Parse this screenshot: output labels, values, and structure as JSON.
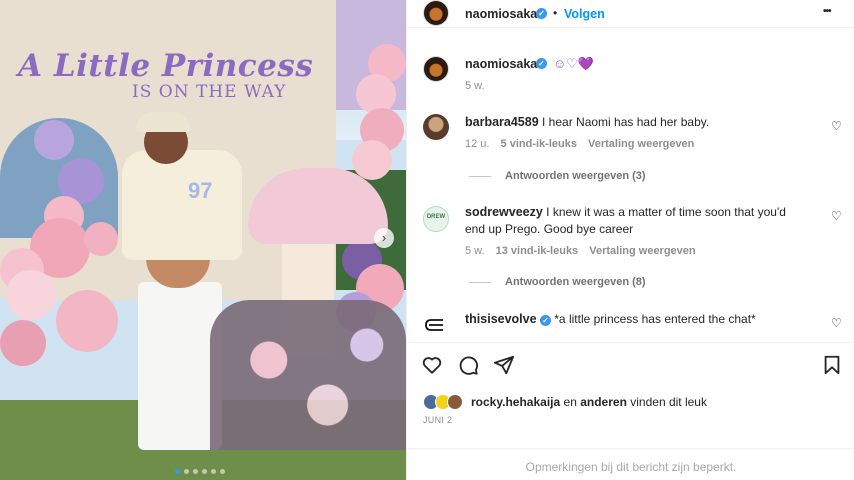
{
  "photo": {
    "sign_line1": "A Little Princess",
    "sign_line2": "IS ON THE WAY",
    "jersey_number": "97",
    "next_glyph": "›"
  },
  "header": {
    "username": "naomiosaka",
    "separator": "•",
    "follow_label": "Volgen",
    "more_glyph": "•••"
  },
  "caption": {
    "username": "naomiosaka",
    "emojis": "☺♡💜",
    "time": "5 w."
  },
  "comments": [
    {
      "username": "barbara4589",
      "text": "I hear Naomi has had her baby.",
      "time": "12 u.",
      "likes": "5 vind-ik-leuks",
      "translate": "Vertaling weergeven",
      "replies": "Antwoorden weergeven (3)"
    },
    {
      "username": "sodrewveezy",
      "text_line1": "I knew it was a matter of time soon that you'd",
      "text_line2": "end up Prego. Good bye career",
      "time": "5 w.",
      "likes": "13 vind-ik-leuks",
      "translate": "Vertaling weergeven",
      "replies": "Antwoorden weergeven (8)",
      "avatar_text": "DREW"
    },
    {
      "username": "thisisevolve",
      "text": "*a little princess has entered the chat*"
    }
  ],
  "actions": {
    "icons": [
      "heart-icon",
      "comment-icon",
      "share-icon",
      "bookmark-icon"
    ]
  },
  "likes": {
    "liker": "rocky.hehakaija",
    "and_label": "en",
    "others": "anderen",
    "suffix": "vinden dit leuk",
    "date": "JUNI 2"
  },
  "footer": {
    "notice": "Opmerkingen bij dit bericht zijn beperkt."
  },
  "colors": {
    "accent": "#0095f6",
    "verified": "#3897f0",
    "text": "#262626",
    "muted": "#8e8e8e"
  }
}
